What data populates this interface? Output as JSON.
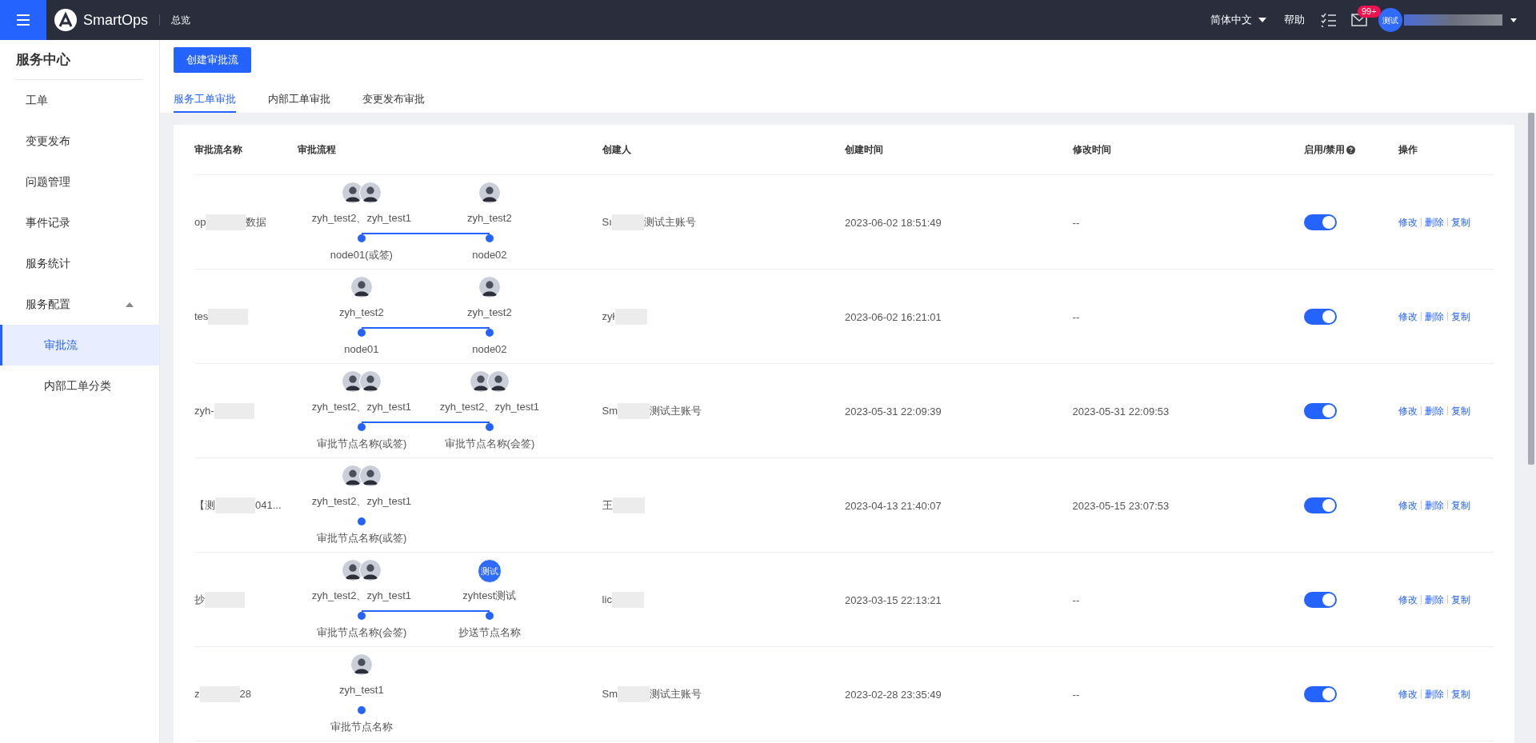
{
  "topbar": {
    "brand": "SmartOps",
    "nav": "总览",
    "language": "简体中文",
    "help": "帮助",
    "mail_badge": "99+",
    "user_avatar": "测试"
  },
  "sidebar": {
    "title": "服务中心",
    "items": [
      {
        "label": "工单",
        "selected": false
      },
      {
        "label": "变更发布",
        "selected": false
      },
      {
        "label": "问题管理",
        "selected": false
      },
      {
        "label": "事件记录",
        "selected": false
      },
      {
        "label": "服务统计",
        "selected": false
      },
      {
        "label": "服务配置",
        "selected": false,
        "expanded": true,
        "children": [
          {
            "label": "审批流",
            "selected": true
          },
          {
            "label": "内部工单分类",
            "selected": false
          }
        ]
      }
    ]
  },
  "create_button": "创建审批流",
  "tabs": [
    {
      "label": "服务工单审批",
      "selected": true
    },
    {
      "label": "内部工单审批",
      "selected": false
    },
    {
      "label": "变更发布审批",
      "selected": false
    }
  ],
  "table": {
    "columns": [
      "审批流名称",
      "审批流程",
      "创建人",
      "创建时间",
      "修改时间",
      "启用/禁用",
      "操作"
    ],
    "rows": [
      {
        "name_start": "op",
        "name_end": "数据",
        "flow": [
          {
            "avatars": [
              {
                "kind": "photo"
              },
              {
                "kind": "photo"
              }
            ],
            "people": "zyh_test2、zyh_test1",
            "label": "node01(或签)"
          },
          {
            "avatars": [
              {
                "kind": "photo"
              }
            ],
            "people": "zyh_test2",
            "label": "node02"
          }
        ],
        "creator_start": "Sı",
        "creator_end": "测试主账号",
        "created": "2023-06-02 18:51:49",
        "modified": "--",
        "on": true,
        "actions": [
          "修改",
          "删除",
          "复制"
        ]
      },
      {
        "name_start": "tes",
        "name_end": "",
        "flow": [
          {
            "avatars": [
              {
                "kind": "photo"
              }
            ],
            "people": "zyh_test2",
            "label": "node01"
          },
          {
            "avatars": [
              {
                "kind": "photo"
              }
            ],
            "people": "zyh_test2",
            "label": "node02"
          }
        ],
        "creator_start": "zył",
        "creator_end": "",
        "created": "2023-06-02 16:21:01",
        "modified": "--",
        "on": true,
        "actions": [
          "修改",
          "删除",
          "复制"
        ]
      },
      {
        "name_start": "zyh-",
        "name_end": "",
        "flow": [
          {
            "avatars": [
              {
                "kind": "photo"
              },
              {
                "kind": "photo"
              }
            ],
            "people": "zyh_test2、zyh_test1",
            "label": "审批节点名称(或签)"
          },
          {
            "avatars": [
              {
                "kind": "photo"
              },
              {
                "kind": "photo"
              }
            ],
            "people": "zyh_test2、zyh_test1",
            "label": "审批节点名称(会签)"
          }
        ],
        "creator_start": "Sm",
        "creator_end": "测试主账号",
        "created": "2023-05-31 22:09:39",
        "modified": "2023-05-31 22:09:53",
        "on": true,
        "actions": [
          "修改",
          "删除",
          "复制"
        ]
      },
      {
        "name_start": "【测",
        "name_end": "041...",
        "flow": [
          {
            "avatars": [
              {
                "kind": "photo"
              },
              {
                "kind": "photo"
              }
            ],
            "people": "zyh_test2、zyh_test1",
            "label": "审批节点名称(或签)"
          }
        ],
        "creator_start": "王",
        "creator_end": "",
        "created": "2023-04-13 21:40:07",
        "modified": "2023-05-15 23:07:53",
        "on": true,
        "actions": [
          "修改",
          "删除",
          "复制"
        ]
      },
      {
        "name_start": "抄",
        "name_end": "",
        "flow": [
          {
            "avatars": [
              {
                "kind": "photo"
              },
              {
                "kind": "photo"
              }
            ],
            "people": "zyh_test2、zyh_test1",
            "label": "审批节点名称(会签)"
          },
          {
            "avatars": [
              {
                "kind": "text",
                "text": "测试"
              }
            ],
            "people": "zyhtest测试",
            "label": "抄送节点名称"
          }
        ],
        "creator_start": "lic",
        "creator_end": "",
        "created": "2023-03-15 22:13:21",
        "modified": "--",
        "on": true,
        "actions": [
          "修改",
          "删除",
          "复制"
        ]
      },
      {
        "name_start": "z",
        "name_end": "28",
        "flow": [
          {
            "avatars": [
              {
                "kind": "photo"
              }
            ],
            "people": "zyh_test1",
            "label": "审批节点名称"
          }
        ],
        "creator_start": "Sm",
        "creator_end": "测试主账号",
        "created": "2023-02-28 23:35:49",
        "modified": "--",
        "on": true,
        "actions": [
          "修改",
          "删除",
          "复制"
        ]
      }
    ]
  }
}
